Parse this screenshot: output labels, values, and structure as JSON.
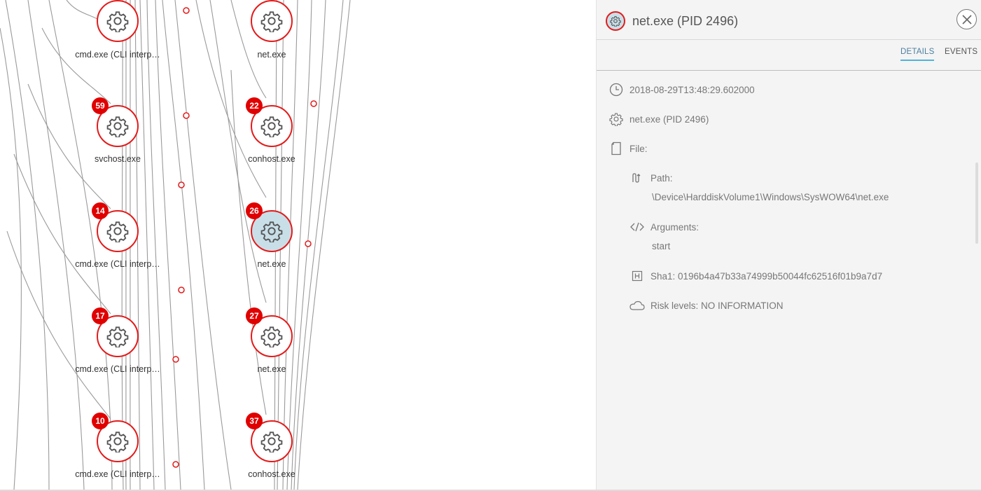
{
  "graph": {
    "nodes": [
      {
        "badge": "",
        "label": "cmd.exe (CLI interp…",
        "selected": false
      },
      {
        "badge": "",
        "label": "net.exe",
        "selected": false
      },
      {
        "badge": "59",
        "label": "svchost.exe",
        "selected": false
      },
      {
        "badge": "22",
        "label": "conhost.exe",
        "selected": false
      },
      {
        "badge": "14",
        "label": "cmd.exe (CLI interp…",
        "selected": false
      },
      {
        "badge": "26",
        "label": "net.exe",
        "selected": true
      },
      {
        "badge": "17",
        "label": "cmd.exe (CLI interp…",
        "selected": false
      },
      {
        "badge": "27",
        "label": "net.exe",
        "selected": false
      },
      {
        "badge": "10",
        "label": "cmd.exe (CLI interp…",
        "selected": false
      },
      {
        "badge": "37",
        "label": "conhost.exe",
        "selected": false
      }
    ]
  },
  "panel": {
    "title": "net.exe (PID 2496)",
    "tabs": {
      "details": "DETAILS",
      "events": "EVENTS"
    },
    "timestamp": "2018-08-29T13:48:29.602000",
    "process": "net.exe (PID 2496)",
    "file_label": "File:",
    "path_label": "Path:",
    "path_value": "\\Device\\HarddiskVolume1\\Windows\\SysWOW64\\net.exe",
    "arguments_label": "Arguments:",
    "arguments_value": "start",
    "sha1": "Sha1: 0196b4a47b33a74999b50044fc62516f01b9a7d7",
    "risk": "Risk levels: NO INFORMATION"
  },
  "colors": {
    "node_border": "#e31b1b",
    "badge": "#e00000",
    "selected_fill": "#c8dfe8",
    "tab_accent": "#4fb3d9"
  }
}
